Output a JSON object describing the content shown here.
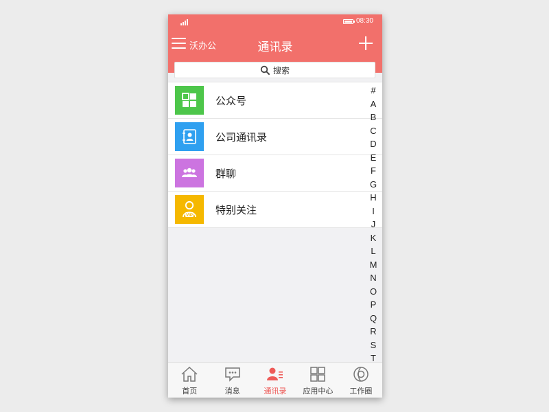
{
  "status_bar": {
    "time": "08:30"
  },
  "nav": {
    "menu_label": "沃办公",
    "title": "通讯录"
  },
  "search": {
    "placeholder": "搜索"
  },
  "list": [
    {
      "label": "公众号",
      "icon": "grid-apps-icon",
      "color": "#4dc64a"
    },
    {
      "label": "公司通讯录",
      "icon": "address-book-icon",
      "color": "#2fa0f0"
    },
    {
      "label": "群聊",
      "icon": "group-people-icon",
      "color": "#cc74e0"
    },
    {
      "label": "特别关注",
      "icon": "vip-user-icon",
      "color": "#f5b800"
    }
  ],
  "alpha_index": [
    "#",
    "A",
    "B",
    "C",
    "D",
    "E",
    "F",
    "G",
    "H",
    "I",
    "J",
    "K",
    "L",
    "M",
    "N",
    "O",
    "P",
    "Q",
    "R",
    "S",
    "T"
  ],
  "tabs": [
    {
      "label": "首页",
      "icon": "home-icon",
      "active": false
    },
    {
      "label": "消息",
      "icon": "message-icon",
      "active": false
    },
    {
      "label": "通讯录",
      "icon": "contacts-icon",
      "active": true
    },
    {
      "label": "应用中心",
      "icon": "app-grid-icon",
      "active": false
    },
    {
      "label": "工作圈",
      "icon": "camera-circle-icon",
      "active": false
    }
  ],
  "colors": {
    "accent": "#f2706b",
    "active_tab": "#ee5b58"
  }
}
